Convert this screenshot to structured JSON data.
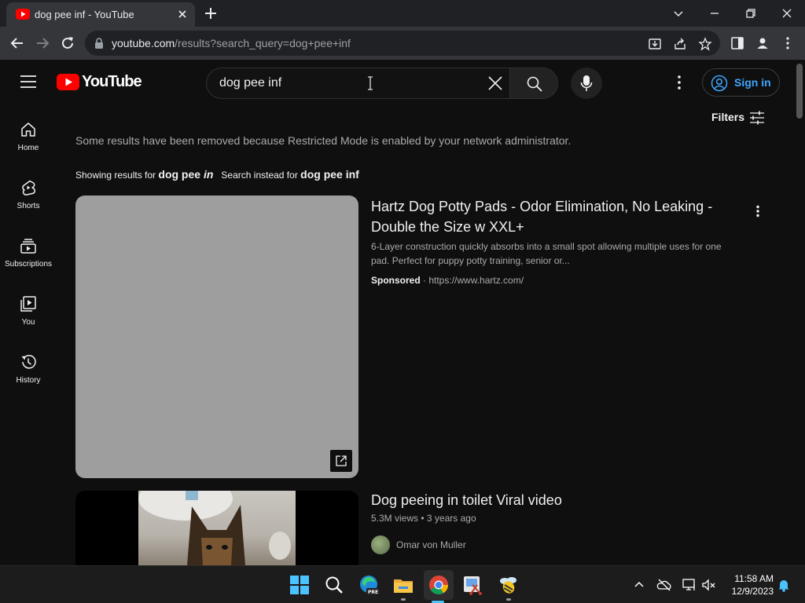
{
  "browser": {
    "tab_title": "dog pee inf - YouTube",
    "url_host": "youtube.com",
    "url_path": "/results?search_query=dog+pee+inf"
  },
  "header": {
    "logo_text": "YouTube",
    "search_value": "dog pee inf",
    "signin_label": "Sign in"
  },
  "guide": [
    {
      "label": "Home",
      "icon": "home-icon"
    },
    {
      "label": "Shorts",
      "icon": "shorts-icon"
    },
    {
      "label": "Subscriptions",
      "icon": "subscriptions-icon"
    },
    {
      "label": "You",
      "icon": "you-icon"
    },
    {
      "label": "History",
      "icon": "history-icon"
    }
  ],
  "filters_label": "Filters",
  "restricted_notice": "Some results have been removed because Restricted Mode is enabled by your network administrator.",
  "correction": {
    "showing_prefix": "Showing results for",
    "showing_query_plain": "dog pee",
    "showing_query_italic": "in",
    "instead_prefix": "Search instead for",
    "instead_query": "dog pee inf"
  },
  "results": [
    {
      "type": "ad",
      "title": "Hartz Dog Potty Pads - Odor Elimination, No Leaking - Double the Size w XXL+",
      "description": "6-Layer construction quickly absorbs into a small spot allowing multiple uses for one pad. Perfect for puppy potty training, senior or...",
      "sponsored_label": "Sponsored",
      "link": "https://www.hartz.com/"
    },
    {
      "type": "video",
      "title": "Dog peeing in toilet Viral video",
      "views": "5.3M views",
      "age": "3 years ago",
      "channel": "Omar von Muller"
    }
  ],
  "taskbar": {
    "time": "11:58 AM",
    "date": "12/9/2023"
  },
  "colors": {
    "background": "#0f0f0f",
    "youtube_red": "#ff0000",
    "link_blue": "#3ea6ff",
    "secondary_text": "#aaaaaa"
  }
}
